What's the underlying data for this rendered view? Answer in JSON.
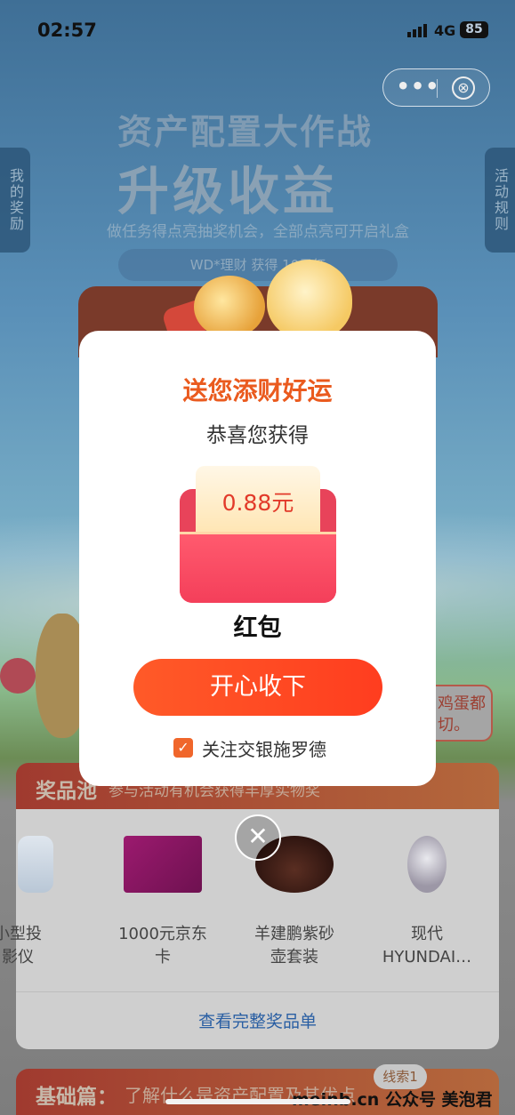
{
  "status_bar": {
    "time": "02:57",
    "network": "4G",
    "battery": "85"
  },
  "capsule": {
    "more_glyph": "•••",
    "close_glyph": "⊗"
  },
  "banner": {
    "title": "资产配置大作战",
    "subtitle": "升级收益",
    "description": "做任务得点亮抽奖机会，全部点亮可开启礼盒",
    "marquee": "WD*理财 获得 10元红"
  },
  "side_tabs": {
    "left": "我的奖励",
    "right": "活动规则"
  },
  "egg_bubble": "鸡蛋都\n切。",
  "modal": {
    "title": "送您添财好运",
    "subtitle": "恭喜您获得",
    "amount": "0.88元",
    "prize_name": "红包",
    "accept_button": "开心收下",
    "follow_checked": true,
    "follow_label": "关注交银施罗德",
    "close_glyph": "✕"
  },
  "prize_pool": {
    "title": "奖品池",
    "subtitle": "参与活动有机会获得丰厚实物奖",
    "items": [
      {
        "name": "小型投\n影仪",
        "icon": "projector"
      },
      {
        "name": "1000元京东\n卡",
        "icon": "jd-card"
      },
      {
        "name": "羊建鹏紫砂\n壶套装",
        "icon": "teapot"
      },
      {
        "name": "现代\nHYUNDAI…",
        "icon": "hyundai-device"
      }
    ],
    "view_all": "查看完整奖品单"
  },
  "basic_section": {
    "title": "基础篇：",
    "subtitle": "了解什么是资产配置及其优点",
    "tag": "线索1"
  },
  "watermark": "meinb.cn 公众号 美泡君",
  "colors": {
    "accent": "#ea5a1e",
    "button": "#ff4a24",
    "link": "#2a5fa3"
  }
}
